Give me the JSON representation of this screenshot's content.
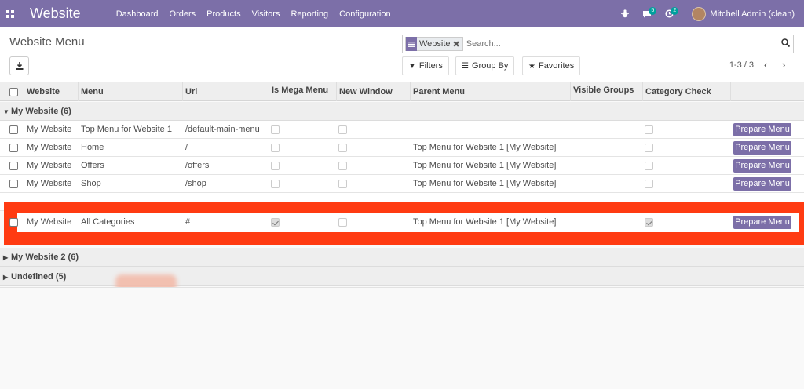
{
  "navbar": {
    "app_icon": "apps-grid-icon",
    "brand": "Website",
    "menu": [
      "Dashboard",
      "Orders",
      "Products",
      "Visitors",
      "Reporting",
      "Configuration"
    ],
    "messages_count": "5",
    "activities_count": "2",
    "user_name": "Mitchell Admin (clean)",
    "color": "#7c6fa8"
  },
  "control_panel": {
    "title": "Website Menu",
    "search": {
      "facet_label": "Website",
      "placeholder": "Search..."
    },
    "filters_label": "Filters",
    "group_by_label": "Group By",
    "favorites_label": "Favorites",
    "pager": "1-3 / 3",
    "prev": "‹",
    "next": "›"
  },
  "table": {
    "columns": [
      "Website",
      "Menu",
      "Url",
      "Is Mega Menu",
      "New Window",
      "Parent Menu",
      "Visible Groups",
      "Category Check"
    ],
    "groups": [
      {
        "label": "My Website (6)",
        "expanded": true
      },
      {
        "label": "My Website 2 (6)",
        "expanded": false
      },
      {
        "label": "Undefined (5)",
        "expanded": false
      }
    ],
    "rows": [
      {
        "website": "My Website",
        "menu": "Top Menu for Website 1",
        "url": "/default-main-menu",
        "mega": false,
        "new_window": false,
        "parent": "",
        "category": false,
        "action": "Prepare Menu"
      },
      {
        "website": "My Website",
        "menu": "Home",
        "url": "/",
        "mega": false,
        "new_window": false,
        "parent": "Top Menu for Website 1 [My Website]",
        "category": false,
        "action": "Prepare Menu"
      },
      {
        "website": "My Website",
        "menu": "Offers",
        "url": "/offers",
        "mega": false,
        "new_window": false,
        "parent": "Top Menu for Website 1 [My Website]",
        "category": false,
        "action": "Prepare Menu"
      },
      {
        "website": "My Website",
        "menu": "Shop",
        "url": "/shop",
        "mega": false,
        "new_window": false,
        "parent": "Top Menu for Website 1 [My Website]",
        "category": false,
        "action": "Prepare Menu"
      },
      {
        "website": "My Website",
        "menu": "All Categories",
        "url": "#",
        "mega": true,
        "new_window": false,
        "parent": "Top Menu for Website 1 [My Website]",
        "category": true,
        "action": "Prepare Menu"
      }
    ],
    "highlight_color": "#ff3b12"
  }
}
